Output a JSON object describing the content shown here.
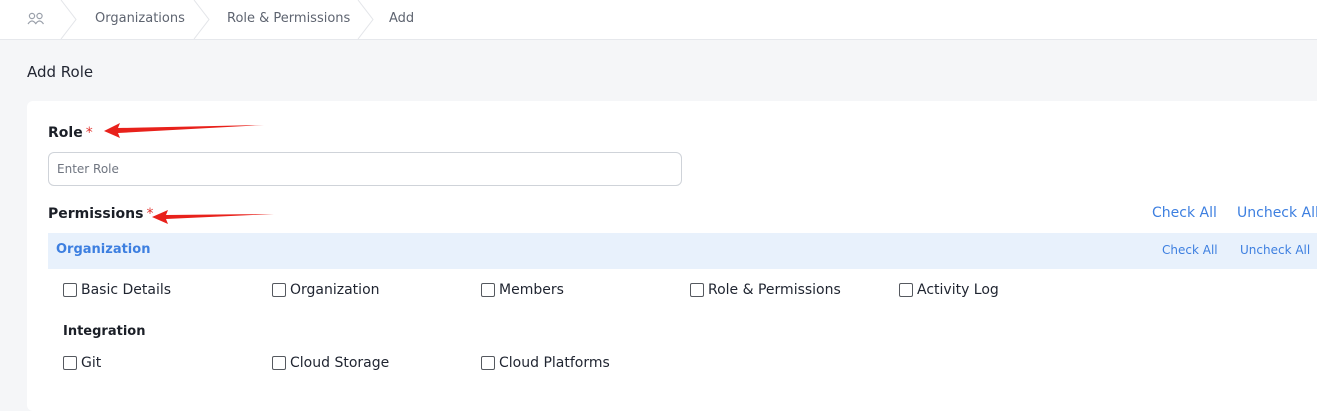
{
  "breadcrumb": {
    "icon": "users-icon",
    "items": [
      "Organizations",
      "Role & Permissions",
      "Add"
    ]
  },
  "page": {
    "title": "Add Role"
  },
  "form": {
    "role_label": "Role",
    "required_mark": "*",
    "role_placeholder": "Enter Role",
    "role_value": "",
    "permissions_label": "Permissions",
    "check_all": "Check All",
    "uncheck_all": "Uncheck All"
  },
  "section": {
    "title": "Organization",
    "check_all": "Check All",
    "uncheck_all": "Uncheck All",
    "items": [
      "Basic Details",
      "Organization",
      "Members",
      "Role & Permissions",
      "Activity Log"
    ],
    "subgroup_title": "Integration",
    "subgroup_items": [
      "Git",
      "Cloud Storage",
      "Cloud Platforms"
    ]
  },
  "colors": {
    "accent": "#3d7fe0",
    "required": "#e0342f",
    "annotation_arrow": "#e8211b",
    "section_bg": "#e8f1fc"
  }
}
